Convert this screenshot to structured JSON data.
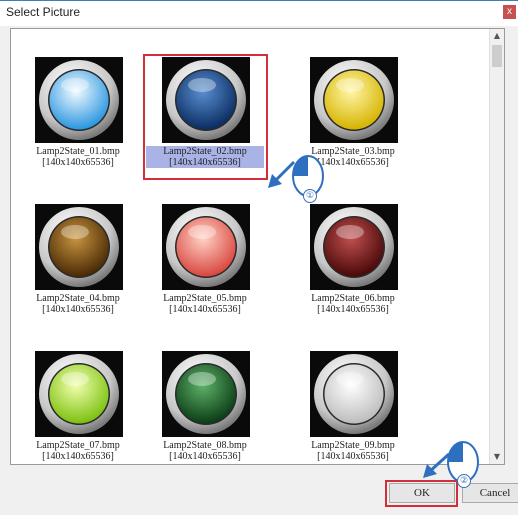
{
  "window": {
    "title": "Select Picture",
    "close_glyph": "x"
  },
  "items": [
    {
      "name": "Lamp2State_01.bmp",
      "size": "[140x140x65536]",
      "color_center": "#f4fbff",
      "color_edge": "#2a96e0"
    },
    {
      "name": "Lamp2State_02.bmp",
      "size": "[140x140x65536]",
      "color_center": "#5b8fd0",
      "color_edge": "#0a2d62",
      "selected": true
    },
    {
      "name": "Lamp2State_03.bmp",
      "size": "[140x140x65536]",
      "color_center": "#fff7a8",
      "color_edge": "#d6b300"
    },
    {
      "name": "Lamp2State_04.bmp",
      "size": "[140x140x65536]",
      "color_center": "#c89540",
      "color_edge": "#4a2a05"
    },
    {
      "name": "Lamp2State_05.bmp",
      "size": "[140x140x65536]",
      "color_center": "#ffd3c8",
      "color_edge": "#d9473e"
    },
    {
      "name": "Lamp2State_06.bmp",
      "size": "[140x140x65536]",
      "color_center": "#c05050",
      "color_edge": "#4a0808"
    },
    {
      "name": "Lamp2State_07.bmp",
      "size": "[140x140x65536]",
      "color_center": "#f2ffb0",
      "color_edge": "#7cc10f"
    },
    {
      "name": "Lamp2State_08.bmp",
      "size": "[140x140x65536]",
      "color_center": "#5fb26a",
      "color_edge": "#0b3d16"
    },
    {
      "name": "Lamp2State_09.bmp",
      "size": "[140x140x65536]",
      "color_center": "#ffffff",
      "color_edge": "#bdbdbd"
    }
  ],
  "buttons": {
    "ok": "OK",
    "cancel": "Cancel"
  },
  "annotations": {
    "step1": "①",
    "step2": "②"
  },
  "colors": {
    "highlight_frame": "#d32f3a",
    "selection": "#a9b3e6",
    "arrow": "#2f6fc0"
  }
}
